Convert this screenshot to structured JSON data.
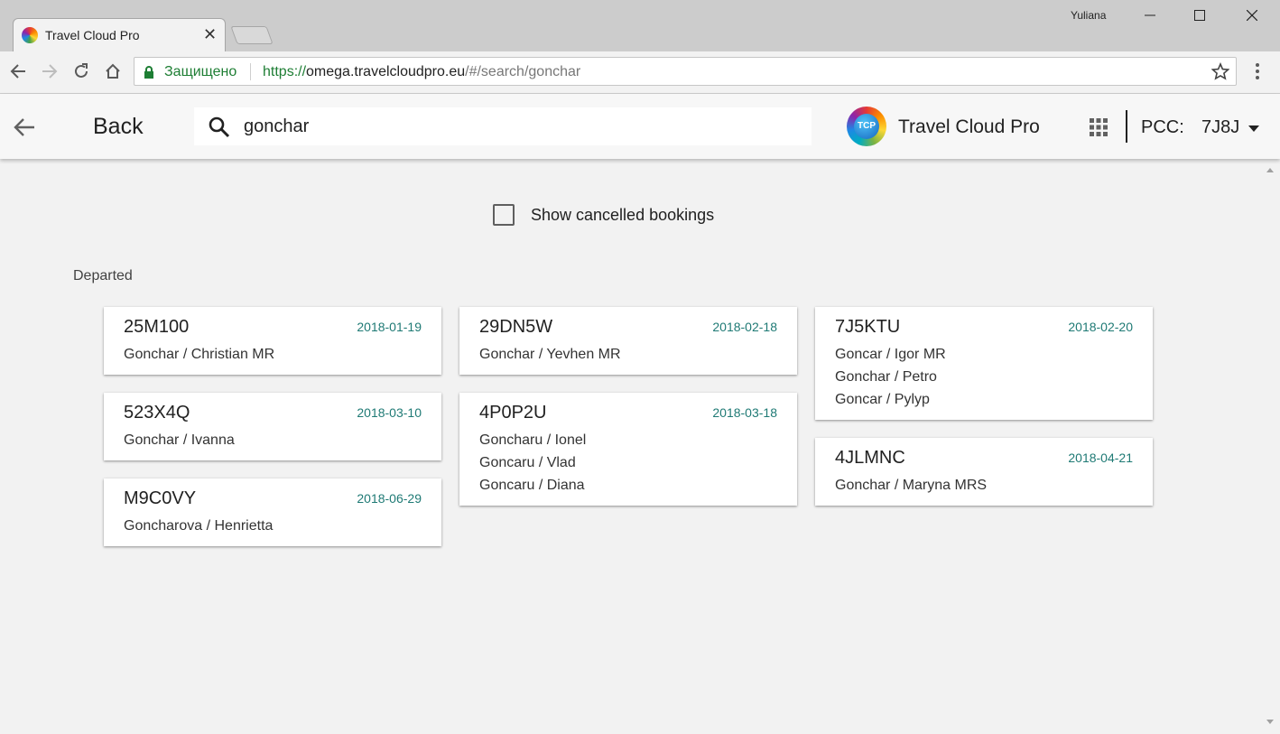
{
  "window": {
    "tab_title": "Travel Cloud Pro",
    "user": "Yuliana"
  },
  "browser": {
    "secure_label": "Защищено",
    "url_scheme": "https://",
    "url_host": "omega.travelcloudpro.eu",
    "url_path": "/#/search/gonchar"
  },
  "header": {
    "back_label": "Back",
    "search_value": "gonchar",
    "brand_logo_text": "TCP",
    "brand_name": "Travel Cloud Pro",
    "pcc_label": "PCC:",
    "pcc_value": "7J8J"
  },
  "filters": {
    "show_cancelled_label": "Show cancelled bookings",
    "show_cancelled_checked": false
  },
  "section": {
    "title": "Departed"
  },
  "columns": [
    {
      "cards": [
        {
          "locator": "25M100",
          "date": "2018-01-19",
          "passengers": [
            "Gonchar / Christian MR"
          ]
        },
        {
          "locator": "523X4Q",
          "date": "2018-03-10",
          "passengers": [
            "Gonchar / Ivanna"
          ]
        },
        {
          "locator": "M9C0VY",
          "date": "2018-06-29",
          "passengers": [
            "Goncharova / Henrietta"
          ]
        }
      ]
    },
    {
      "cards": [
        {
          "locator": "29DN5W",
          "date": "2018-02-18",
          "passengers": [
            "Gonchar / Yevhen MR"
          ]
        },
        {
          "locator": "4P0P2U",
          "date": "2018-03-18",
          "passengers": [
            "Goncharu / Ionel",
            "Goncaru / Vlad",
            "Goncaru / Diana"
          ]
        }
      ]
    },
    {
      "cards": [
        {
          "locator": "7J5KTU",
          "date": "2018-02-20",
          "passengers": [
            "Goncar / Igor MR",
            "Gonchar / Petro",
            "Goncar / Pylyp"
          ]
        },
        {
          "locator": "4JLMNC",
          "date": "2018-04-21",
          "passengers": [
            "Gonchar / Maryna MRS"
          ]
        }
      ]
    }
  ],
  "colors": {
    "date": "#1f7a75",
    "secure": "#1e7e34",
    "page_bg": "#f2f2f2"
  },
  "icons": {
    "back": "arrow-left-icon",
    "search": "search-icon",
    "apps": "apps-grid-icon",
    "dropdown": "caret-down-icon"
  }
}
